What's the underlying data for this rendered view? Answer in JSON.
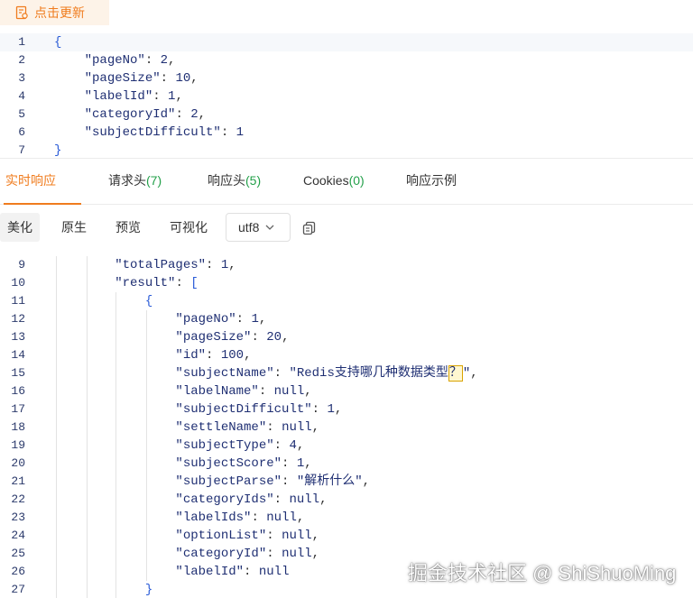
{
  "toolbar": {
    "refresh_label": "点击更新"
  },
  "request_body": {
    "lines": [
      {
        "n": "1",
        "text": "{"
      },
      {
        "n": "2",
        "text": "    \"pageNo\": 2,"
      },
      {
        "n": "3",
        "text": "    \"pageSize\": 10,"
      },
      {
        "n": "4",
        "text": "    \"labelId\": 1,"
      },
      {
        "n": "5",
        "text": "    \"categoryId\": 2,"
      },
      {
        "n": "6",
        "text": "    \"subjectDifficult\": 1"
      },
      {
        "n": "7",
        "text": "}"
      }
    ]
  },
  "tabs": [
    {
      "label": "实时响应",
      "count": ""
    },
    {
      "label": "请求头",
      "count": "(7)"
    },
    {
      "label": "响应头",
      "count": "(5)"
    },
    {
      "label": "Cookies",
      "count": "(0)"
    },
    {
      "label": "响应示例",
      "count": ""
    }
  ],
  "response_toolbar": {
    "modes": [
      "美化",
      "原生",
      "预览",
      "可视化"
    ],
    "encoding": "utf8"
  },
  "response_body": {
    "lines": [
      {
        "n": "9",
        "text": "        \"totalPages\": 1,"
      },
      {
        "n": "10",
        "text": "        \"result\": ["
      },
      {
        "n": "11",
        "text": "            {"
      },
      {
        "n": "12",
        "text": "                \"pageNo\": 1,"
      },
      {
        "n": "13",
        "text": "                \"pageSize\": 20,"
      },
      {
        "n": "14",
        "text": "                \"id\": 100,"
      },
      {
        "n": "15",
        "text": "                \"subjectName\": \"Redis支持哪几种数据类型？\","
      },
      {
        "n": "16",
        "text": "                \"labelName\": null,"
      },
      {
        "n": "17",
        "text": "                \"subjectDifficult\": 1,"
      },
      {
        "n": "18",
        "text": "                \"settleName\": null,"
      },
      {
        "n": "19",
        "text": "                \"subjectType\": 4,"
      },
      {
        "n": "20",
        "text": "                \"subjectScore\": 1,"
      },
      {
        "n": "21",
        "text": "                \"subjectParse\": \"解析什么\","
      },
      {
        "n": "22",
        "text": "                \"categoryIds\": null,"
      },
      {
        "n": "23",
        "text": "                \"labelIds\": null,"
      },
      {
        "n": "24",
        "text": "                \"optionList\": null,"
      },
      {
        "n": "25",
        "text": "                \"categoryId\": null,"
      },
      {
        "n": "26",
        "text": "                \"labelId\": null"
      },
      {
        "n": "27",
        "text": "            }"
      }
    ]
  },
  "watermark": "掘金技术社区 @ ShiShuoMing"
}
